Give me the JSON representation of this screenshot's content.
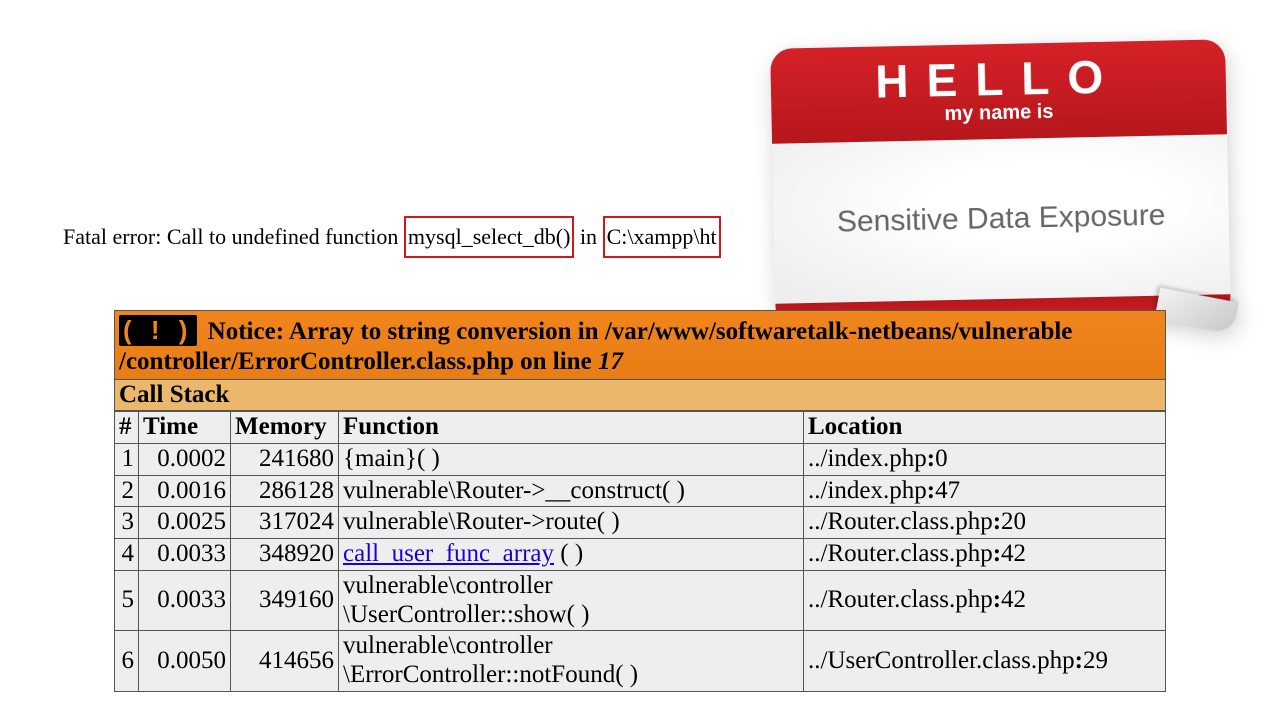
{
  "error_line": {
    "prefix": "Fatal error: Call to undefined function",
    "highlight1": "mysql_select_db()",
    "mid": "in",
    "highlight2": "C:\\xampp\\ht"
  },
  "nametag": {
    "hello": "HELLO",
    "subtitle": "my name is",
    "title": "Sensitive Data Exposure"
  },
  "xdebug": {
    "warn_icon": "( ! )",
    "notice_a": "Notice: Array to string conversion in /var/www/softwaretalk-netbeans/vulnerable",
    "notice_b": "/controller/ErrorController.class.php on line ",
    "notice_line": "17",
    "callstack_label": "Call Stack",
    "headers": {
      "num": "#",
      "time": "Time",
      "memory": "Memory",
      "function": "Function",
      "location": "Location"
    },
    "rows": [
      {
        "n": "1",
        "time": "0.0002",
        "mem": "241680",
        "func_plain": "{main}( )",
        "loc_pre": "../index.php",
        "loc_b": ":",
        "loc_post": "0"
      },
      {
        "n": "2",
        "time": "0.0016",
        "mem": "286128",
        "func_plain": "vulnerable\\Router->__construct( )",
        "loc_pre": "../index.php",
        "loc_b": ":",
        "loc_post": "47"
      },
      {
        "n": "3",
        "time": "0.0025",
        "mem": "317024",
        "func_plain": "vulnerable\\Router->route( )",
        "loc_pre": "../Router.class.php",
        "loc_b": ":",
        "loc_post": "20"
      },
      {
        "n": "4",
        "time": "0.0033",
        "mem": "348920",
        "func_link": "call_user_func_array",
        "func_after": " ( )",
        "loc_pre": "../Router.class.php",
        "loc_b": ":",
        "loc_post": "42"
      },
      {
        "n": "5",
        "time": "0.0033",
        "mem": "349160",
        "func_plain": "vulnerable\\controller\n\\UserController::show( )",
        "loc_pre": "../Router.class.php",
        "loc_b": ":",
        "loc_post": "42"
      },
      {
        "n": "6",
        "time": "0.0050",
        "mem": "414656",
        "func_plain": "vulnerable\\controller\n\\ErrorController::notFound( )",
        "loc_pre": "../UserController.class.php",
        "loc_b": ":",
        "loc_post": "29"
      }
    ]
  }
}
